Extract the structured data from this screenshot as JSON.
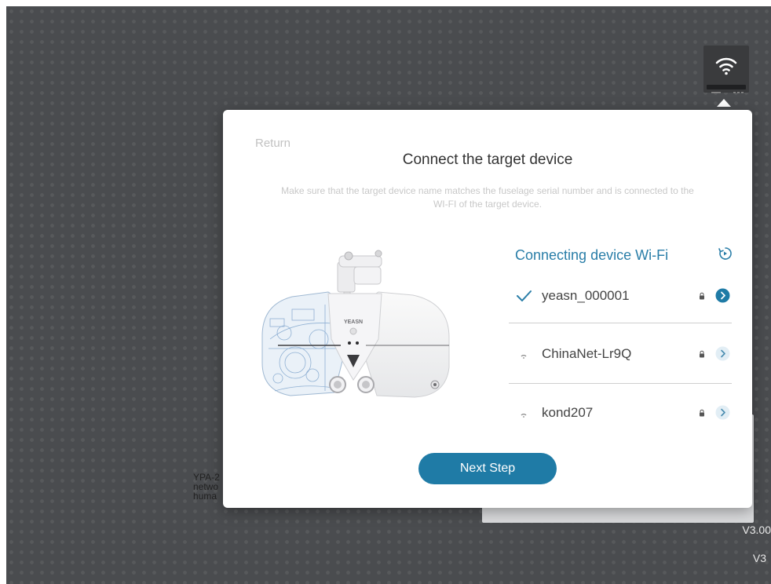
{
  "background": {
    "description_lines": [
      "YPA-2",
      "netwo",
      "huma"
    ],
    "version_label": "V3.00",
    "version_short": "V3"
  },
  "dialog": {
    "return_label": "Return",
    "title": "Connect the target device",
    "subtitle": "Make sure that the target device name matches the fuselage serial number and is connected to the WI-FI of the target device.",
    "wifi_section_title": "Connecting device Wi-Fi",
    "wifi_networks": [
      {
        "ssid": "yeasn_000001",
        "status": "connected",
        "locked": true
      },
      {
        "ssid": "ChinaNet-Lr9Q",
        "status": "available",
        "locked": true
      },
      {
        "ssid": "kond207",
        "status": "available",
        "locked": true
      }
    ],
    "next_button_label": "Next Step",
    "device_logo": "YEASN"
  },
  "colors": {
    "accent": "#1f7ba6",
    "title_blue": "#2a7ea8",
    "background": "#4a4c4f"
  },
  "icons": {
    "wifi_device": "wifi-router-icon",
    "refresh": "refresh-icon",
    "connected": "checkmark-icon",
    "signal": "wifi-signal-icon",
    "lock": "lock-icon",
    "arrow": "chevron-right-icon"
  }
}
